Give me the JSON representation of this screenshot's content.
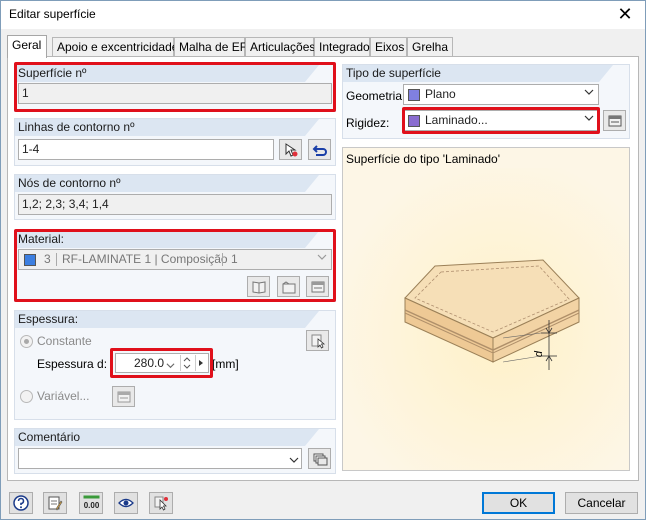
{
  "window": {
    "title": "Editar superfície",
    "close_label": "✕"
  },
  "tabs": [
    {
      "label": "Geral",
      "active": true
    },
    {
      "label": "Apoio e excentricidade"
    },
    {
      "label": "Malha de EF"
    },
    {
      "label": "Articulações"
    },
    {
      "label": "Integrado"
    },
    {
      "label": "Eixos"
    },
    {
      "label": "Grelha"
    }
  ],
  "surface_no": {
    "label": "Superfície nº",
    "value": "1"
  },
  "boundary_lines": {
    "label": "Linhas de contorno nº",
    "value": "1-4"
  },
  "boundary_nodes": {
    "label": "Nós de contorno nº",
    "value": "1,2; 2,3; 3,4; 1,4"
  },
  "material": {
    "label": "Material:",
    "number": "3",
    "value": "RF-LAMINATE 1 | Composição 1",
    "swatch_color": "#3d7fe0"
  },
  "thickness": {
    "label": "Espessura:",
    "constant_label": "Constante",
    "thickness_d_label": "Espessura d:",
    "value": "280.0",
    "unit": "[mm]",
    "variable_label": "Variável..."
  },
  "comment": {
    "label": "Comentário",
    "value": ""
  },
  "surface_type": {
    "label": "Tipo de superfície",
    "geometry_label": "Geometria:",
    "geometry_value": "Plano",
    "geometry_color": "#8080e0",
    "stiffness_label": "Rigidez:",
    "stiffness_value": "Laminado...",
    "stiffness_color": "#8a6cd0"
  },
  "preview": {
    "caption": "Superfície do tipo 'Laminado'",
    "dim_label": "d"
  },
  "footer": {
    "ok_label": "OK",
    "cancel_label": "Cancelar",
    "numeric_icon_text": "0.00"
  }
}
